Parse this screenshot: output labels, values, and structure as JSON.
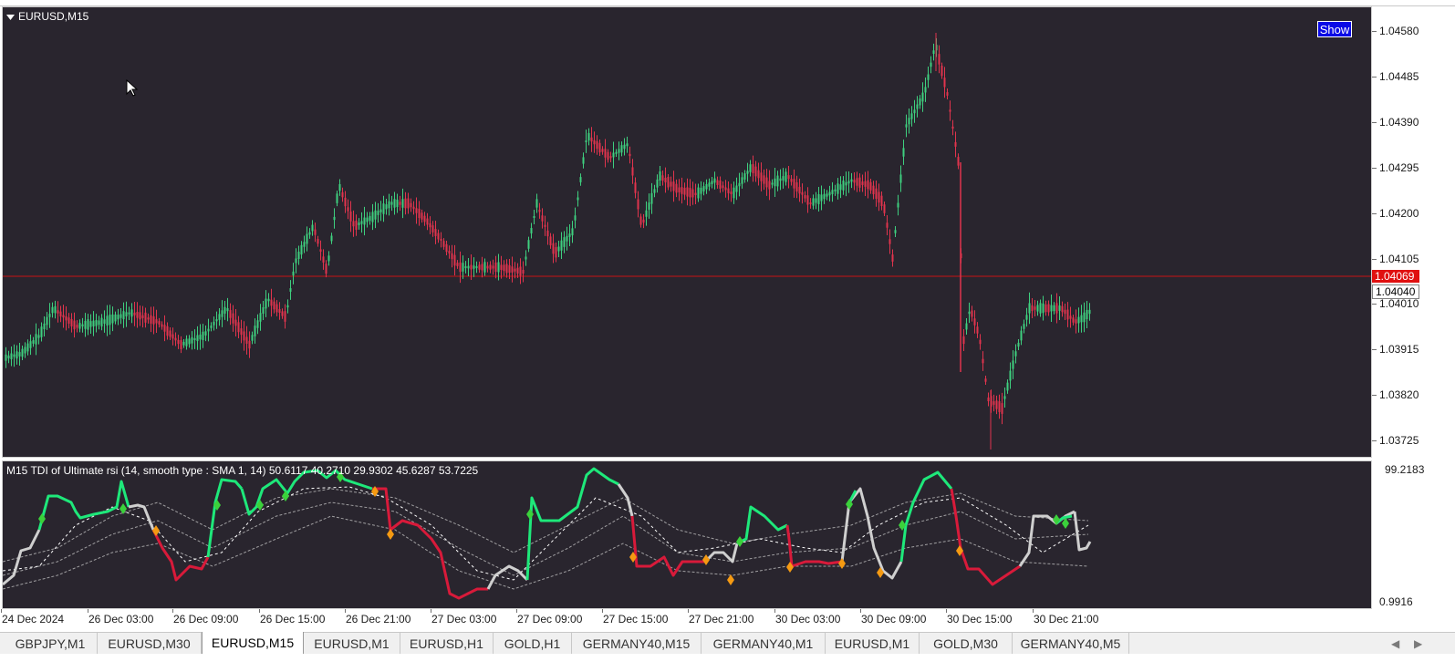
{
  "main_chart": {
    "title": "EURUSD,M15",
    "show_button": "Show",
    "current_bid": "1.04069",
    "current_line": "1.04040",
    "colors": {
      "background": "#29252e",
      "bull": "#3ecf7f",
      "bear": "#e0344d",
      "bid_line": "#c81414"
    }
  },
  "price_axis": {
    "labels": [
      "1.04580",
      "1.04485",
      "1.04390",
      "1.04295",
      "1.04200",
      "1.04105",
      "1.04010",
      "1.03915",
      "1.03820",
      "1.03725"
    ]
  },
  "indicator": {
    "title": "M15 TDI of Ultimate rsi  (14, smooth type :  SMA 1, 14) 50.6117 40.2710 29.9302 45.6287 53.7225",
    "max_label": "99.2183",
    "min_label": "0.9916",
    "colors": {
      "up": "#1ee87a",
      "down": "#d81a3a",
      "neutral": "#cfcfcf",
      "signal_buy": "#3bd13b",
      "signal_sell": "#f59a12"
    }
  },
  "time_axis": {
    "labels": [
      "24 Dec 2024",
      "26 Dec 03:00",
      "26 Dec 09:00",
      "26 Dec 15:00",
      "26 Dec 21:00",
      "27 Dec 03:00",
      "27 Dec 09:00",
      "27 Dec 15:00",
      "27 Dec 21:00",
      "30 Dec 03:00",
      "30 Dec 09:00",
      "30 Dec 15:00",
      "30 Dec 21:00"
    ]
  },
  "tabs": [
    {
      "label": "GBPJPY,M1",
      "active": false
    },
    {
      "label": "EURUSD,M30",
      "active": false
    },
    {
      "label": "EURUSD,M15",
      "active": true
    },
    {
      "label": "EURUSD,M1",
      "active": false
    },
    {
      "label": "EURUSD,H1",
      "active": false
    },
    {
      "label": "GOLD,H1",
      "active": false
    },
    {
      "label": "GERMANY40,M15",
      "active": false
    },
    {
      "label": "GERMANY40,M1",
      "active": false
    },
    {
      "label": "EURUSD,M1",
      "active": false
    },
    {
      "label": "GOLD,M30",
      "active": false
    },
    {
      "label": "GERMANY40,M5",
      "active": false
    }
  ],
  "icons": {
    "title_dropdown": "triangle-down-icon",
    "cursor": "mouse-pointer-icon",
    "scroll_left": "scroll-left-icon",
    "scroll_right": "scroll-right-icon"
  }
}
